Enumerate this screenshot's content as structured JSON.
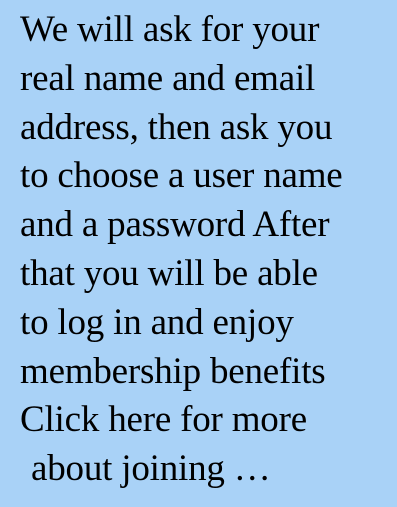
{
  "panel": {
    "background": "#a9d2f7",
    "text_color": "#000000",
    "lines": [
      "We will ask for your",
      "real name and email",
      "address, then ask you",
      "to choose a user name",
      "and a password After",
      "that you will be able",
      "to log in and enjoy",
      "membership benefits",
      "Click here for more",
      "about joining …"
    ]
  }
}
